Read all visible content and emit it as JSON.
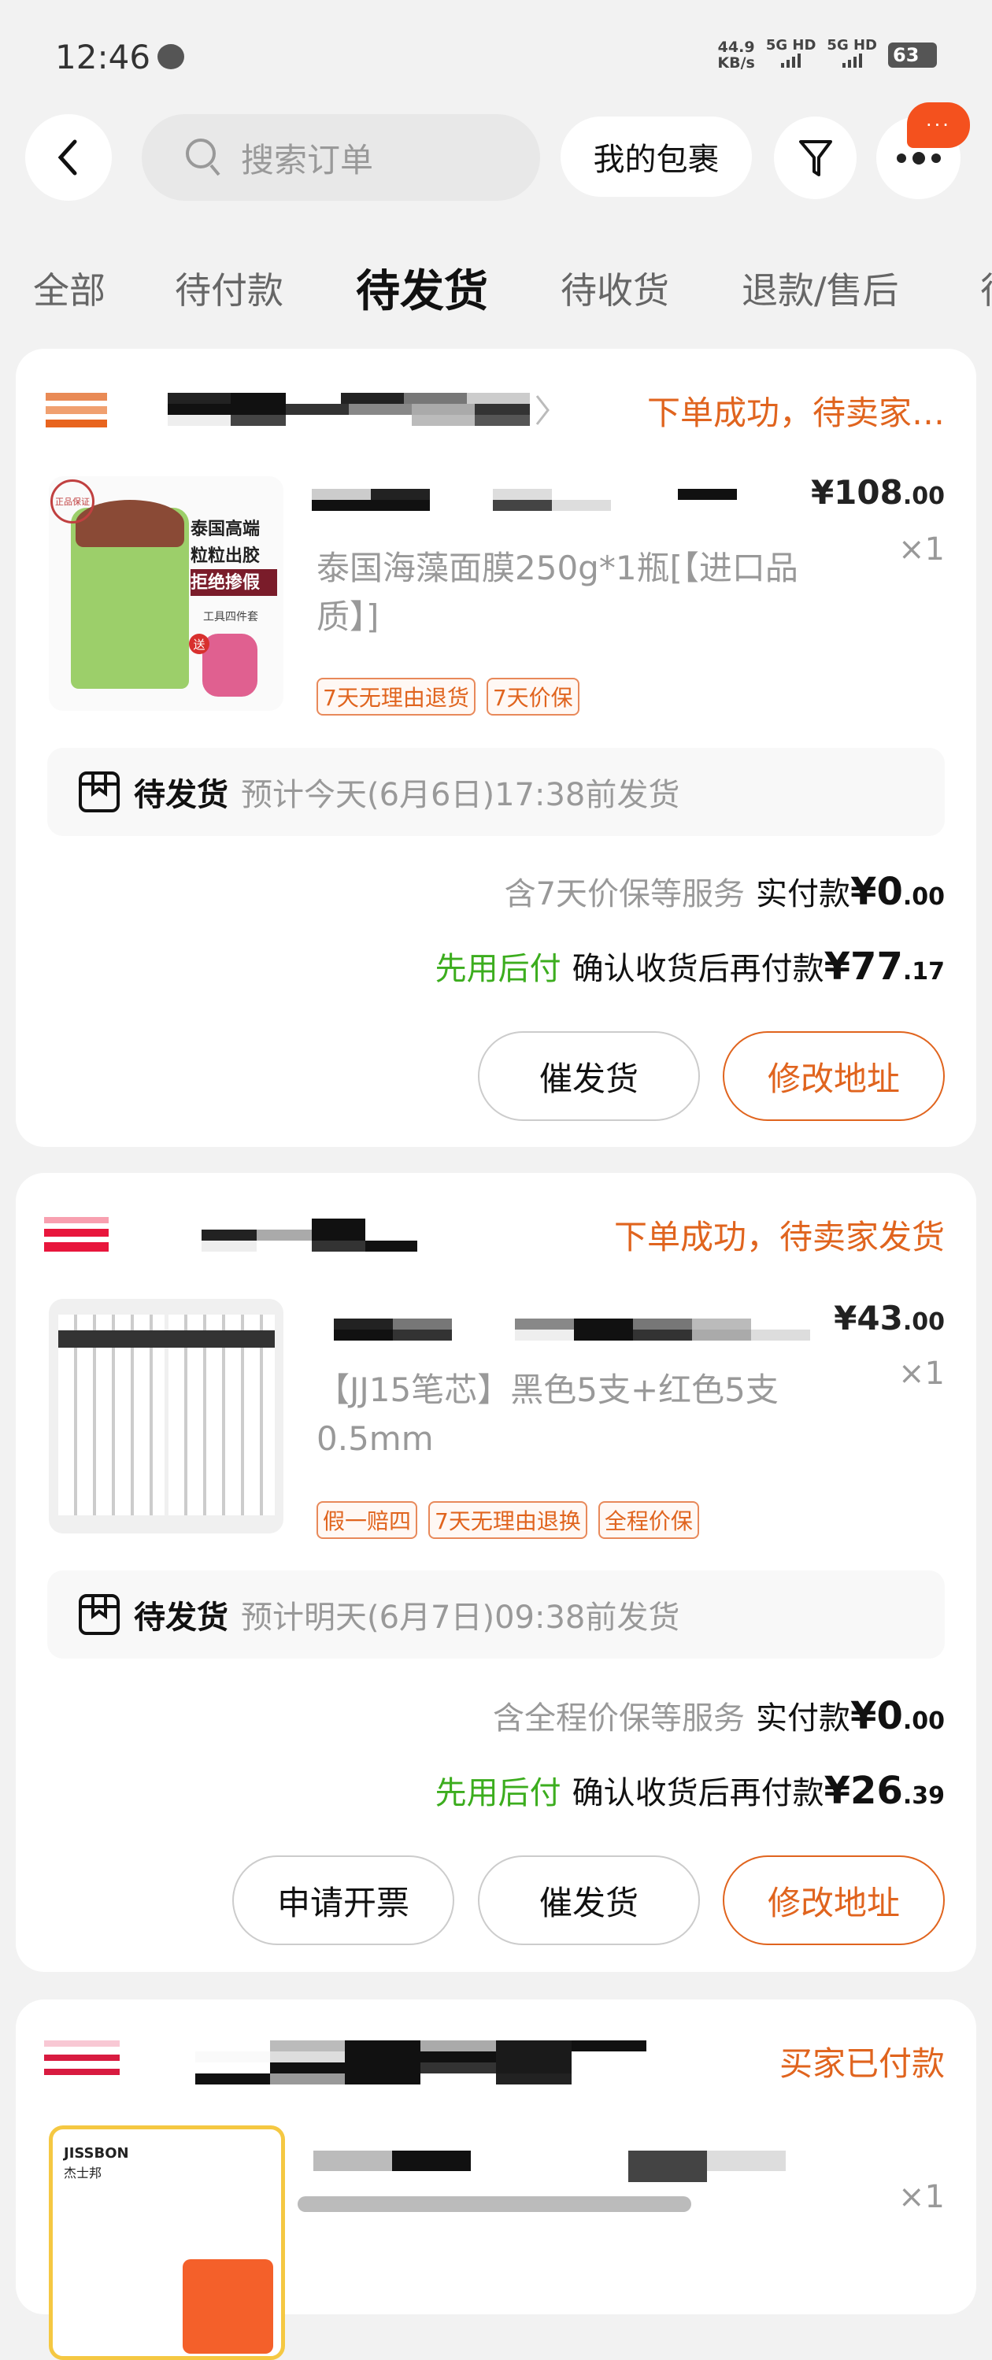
{
  "status_bar": {
    "time": "12:46",
    "speed_value": "44.9",
    "speed_unit": "KB/s",
    "sim1": "5G HD",
    "sim2": "5G HD",
    "battery": "63"
  },
  "header": {
    "search_placeholder": "搜索订单",
    "packages_label": "我的包裹",
    "more_badge": "···"
  },
  "tabs": [
    {
      "label": "全部"
    },
    {
      "label": "待付款"
    },
    {
      "label": "待发货",
      "active": true
    },
    {
      "label": "待收货"
    },
    {
      "label": "退款/售后"
    },
    {
      "label": "待"
    }
  ],
  "orders": [
    {
      "status": "下单成功，待卖家…",
      "product_name": "泰国海藻面膜250g*1瓶[【进口品质】]",
      "price_int": "¥108",
      "price_dec": ".00",
      "qty": "×1",
      "tags": [
        "7天无理由退货",
        "7天价保"
      ],
      "image_text": [
        "正品保证",
        "泰国高端",
        "粒粒出胶",
        "拒绝掺假",
        "工具四件套",
        "送"
      ],
      "ship_status": "待发货",
      "ship_eta": "预计今天(6月6日)17:38前发货",
      "service_note": "含7天价保等服务",
      "paid_label": "实付款",
      "paid_int": "¥0",
      "paid_dec": ".00",
      "paylater_label": "先用后付",
      "after_label": "确认收货后再付款",
      "after_int": "¥77",
      "after_dec": ".17",
      "buttons": [
        "催发货",
        "修改地址"
      ]
    },
    {
      "status": "下单成功，待卖家发货",
      "product_name": "【JJ15笔芯】黑色5支+红色5支0.5mm",
      "price_int": "¥43",
      "price_dec": ".00",
      "qty": "×1",
      "tags": [
        "假一赔四",
        "7天无理由退换",
        "全程价保"
      ],
      "ship_status": "待发货",
      "ship_eta": "预计明天(6月7日)09:38前发货",
      "service_note": "含全程价保等服务",
      "paid_label": "实付款",
      "paid_int": "¥0",
      "paid_dec": ".00",
      "paylater_label": "先用后付",
      "after_label": "确认收货后再付款",
      "after_int": "¥26",
      "after_dec": ".39",
      "buttons": [
        "申请开票",
        "催发货",
        "修改地址"
      ]
    },
    {
      "status": "买家已付款",
      "qty": "×1",
      "image_text": [
        "JISSBON",
        "杰士邦"
      ]
    }
  ],
  "colors": {
    "accent": "#e0641e",
    "paylater_green": "#3cad1e",
    "badge": "#f4511e"
  }
}
